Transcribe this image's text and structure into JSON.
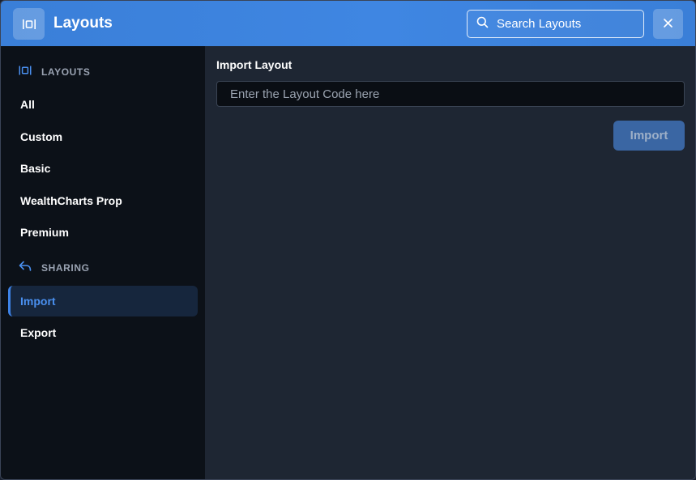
{
  "header": {
    "app_icon": "layout-columns-icon",
    "title": "Layouts",
    "search_icon": "search-icon",
    "search_label": "Search Layouts",
    "close_icon": "close-icon"
  },
  "sidebar": {
    "layouts_section": {
      "icon": "layout-columns-icon",
      "label": "LAYOUTS"
    },
    "layouts_items": [
      {
        "label": "All"
      },
      {
        "label": "Custom"
      },
      {
        "label": "Basic"
      },
      {
        "label": "WealthCharts Prop"
      },
      {
        "label": "Premium"
      }
    ],
    "sharing_section": {
      "icon": "share-reply-icon",
      "label": "SHARING"
    },
    "sharing_items": [
      {
        "label": "Import",
        "active": true
      },
      {
        "label": "Export",
        "active": false
      }
    ]
  },
  "main": {
    "heading": "Import Layout",
    "code_input": {
      "value": "",
      "placeholder": "Enter the Layout Code here"
    },
    "import_button": "Import"
  },
  "colors": {
    "header_gradient": "#3f86e2",
    "accent": "#4a90f0",
    "sidebar_bg": "#0c1118",
    "main_bg": "#1e2633",
    "button_bg": "#3a66a3"
  }
}
